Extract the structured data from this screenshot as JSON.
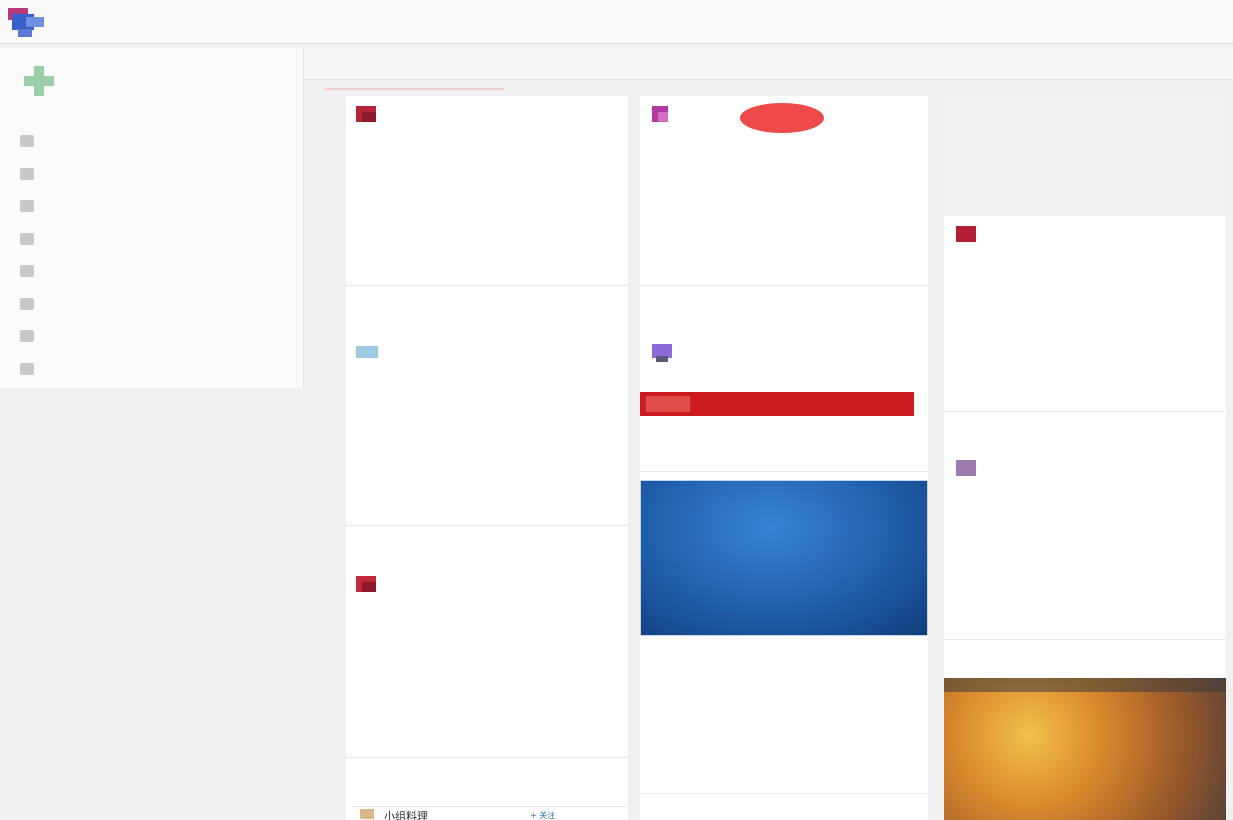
{
  "header": {
    "brand": "",
    "brand_sub": "",
    "center_text": ""
  },
  "subnav": {
    "tabs": [
      {
        "top": "",
        "bottom": ""
      },
      {
        "top": "",
        "bottom": ""
      },
      {
        "top": "",
        "bottom": ""
      },
      {
        "top": "",
        "bottom": ""
      }
    ]
  },
  "sidebar": {
    "profile_line1": "",
    "profile_line2": "",
    "items": [
      {
        "label": "",
        "sub": ""
      },
      {
        "label": "",
        "sub": ""
      },
      {
        "label": "",
        "sub": ""
      },
      {
        "label": "",
        "sub": ""
      },
      {
        "label": "",
        "sub": ""
      },
      {
        "label": "",
        "sub": ""
      },
      {
        "label": "",
        "sub": ""
      },
      {
        "label": "",
        "sub": ""
      }
    ],
    "footer_line1": "",
    "footer_line2": ""
  },
  "feed": {
    "bottom_tab_title": "小组料理",
    "bottom_tab_follow": "+ 关注"
  },
  "colors": {
    "accent_red": "#cc1b22",
    "link_blue": "#5b8fd6",
    "tag_pink": "#e58a8a"
  }
}
